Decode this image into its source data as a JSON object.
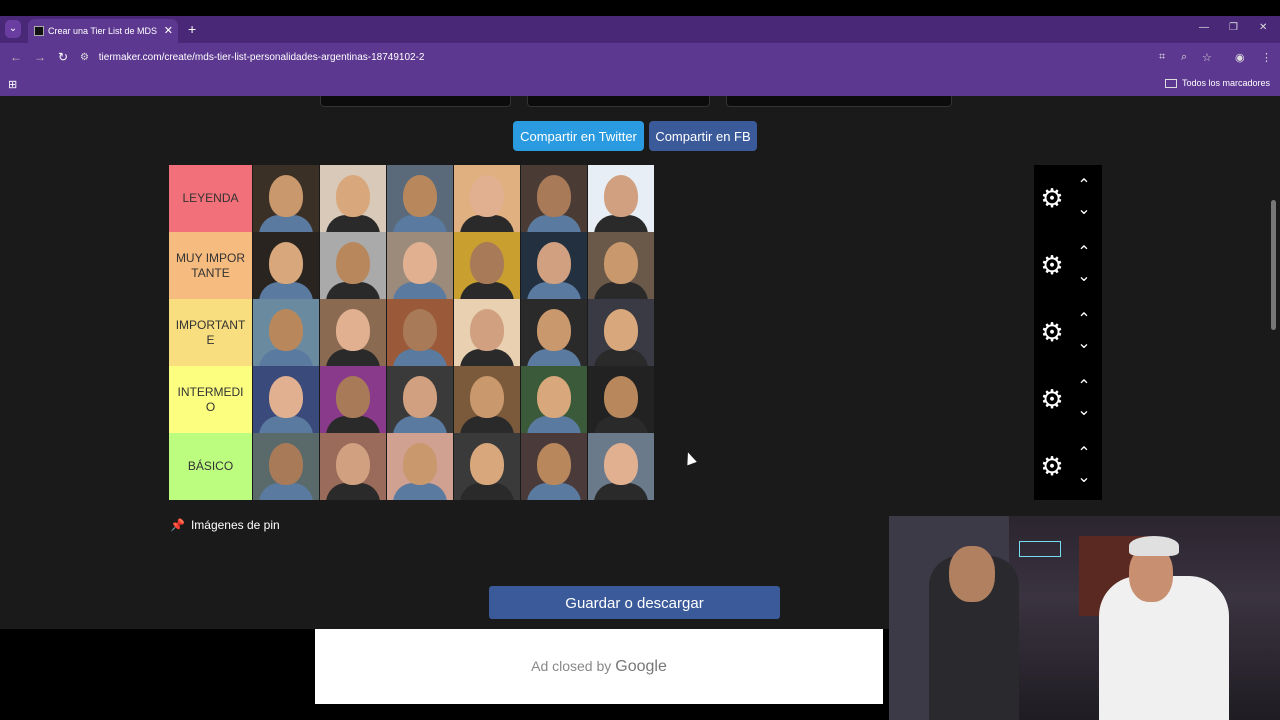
{
  "browser": {
    "tab_title": "Crear una Tier List de MDS Pers",
    "tab_close": "✕",
    "new_tab": "+",
    "dropdown": "⌄",
    "url": "tiermaker.com/create/mds-tier-list-personalidades-argentinas-18749102-2",
    "bookmarks_all": "Todos los marcadores",
    "win_min": "—",
    "win_restore": "❐",
    "win_close": "✕"
  },
  "share": {
    "twitter_label": "Compartir en Twitter",
    "fb_label": "Compartir en FB"
  },
  "tiers": [
    {
      "label": "LEYENDA",
      "color": "#f1707a",
      "items": 6
    },
    {
      "label": "MUY IMPORTANTE",
      "color": "#f6bb7f",
      "items": 6
    },
    {
      "label": "IMPORTANTE",
      "color": "#f9de7f",
      "items": 6
    },
    {
      "label": "INTERMEDIO",
      "color": "#fbfe7f",
      "items": 6
    },
    {
      "label": "BÁSICO",
      "color": "#bcfc7f",
      "items": 6
    }
  ],
  "pin_label": "Imágenes de pin",
  "save_label": "Guardar o descargar",
  "ad": {
    "text": "Ad closed by",
    "brand": "Google"
  },
  "icons": {
    "gear": "⚙",
    "up": "⌃",
    "down": "⌄",
    "pin": "📌"
  }
}
